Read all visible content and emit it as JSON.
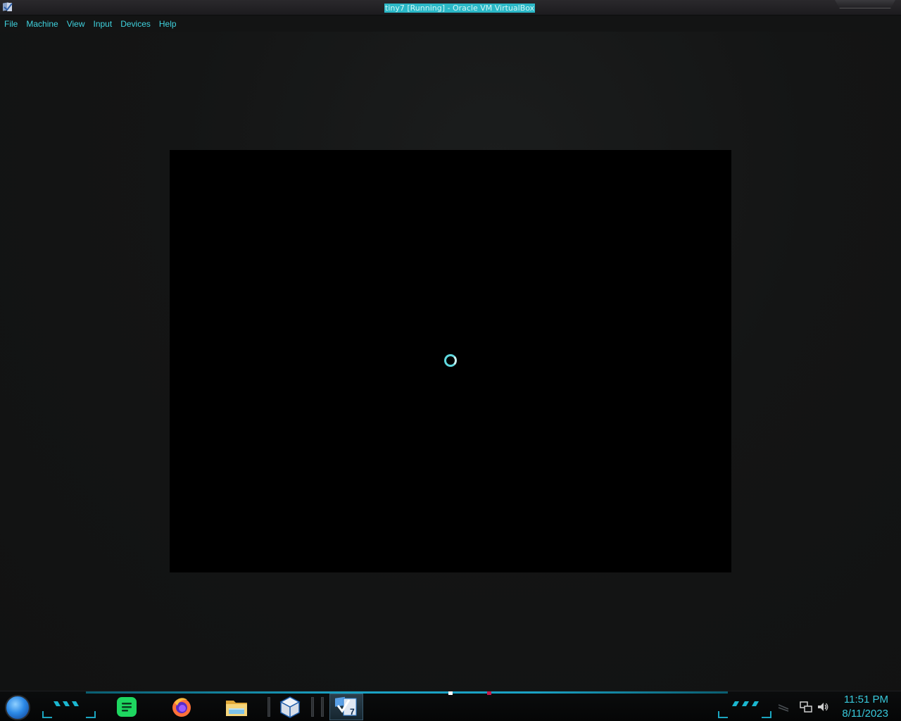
{
  "window": {
    "title": "tiny7 [Running] - Oracle VM VirtualBox",
    "app_icon": "virtualbox-icon"
  },
  "menu": {
    "items": [
      {
        "label": "File"
      },
      {
        "label": "Machine"
      },
      {
        "label": "View"
      },
      {
        "label": "Input"
      },
      {
        "label": "Devices"
      },
      {
        "label": "Help"
      }
    ]
  },
  "vm": {
    "state": "loading",
    "spinner_icon": "loading-spinner-icon"
  },
  "taskbar": {
    "start_icon": "start-orb-icon",
    "apps": [
      {
        "name": "spotify",
        "icon": "spotify-icon",
        "color": "#1ed760"
      },
      {
        "name": "firefox",
        "icon": "firefox-icon",
        "color": "#ff7139"
      },
      {
        "name": "file-explorer",
        "icon": "folder-icon",
        "color": "#f3c94b"
      },
      {
        "name": "virtualbox",
        "icon": "virtualbox-icon",
        "color": "#1c5aa8"
      },
      {
        "name": "tiny7-vm",
        "icon": "windows7-vm-icon",
        "color": "#2f7fd3",
        "active": true,
        "badge": "7"
      }
    ],
    "tray": {
      "icons": [
        "network-icon",
        "volume-icon"
      ],
      "time": "11:51 PM",
      "date": "8/11/2023"
    }
  },
  "colors": {
    "accent": "#3fd3df",
    "taskbar_accent": "#1aa1c4",
    "background": "#131414",
    "title_highlight": "#2bb8c7"
  }
}
